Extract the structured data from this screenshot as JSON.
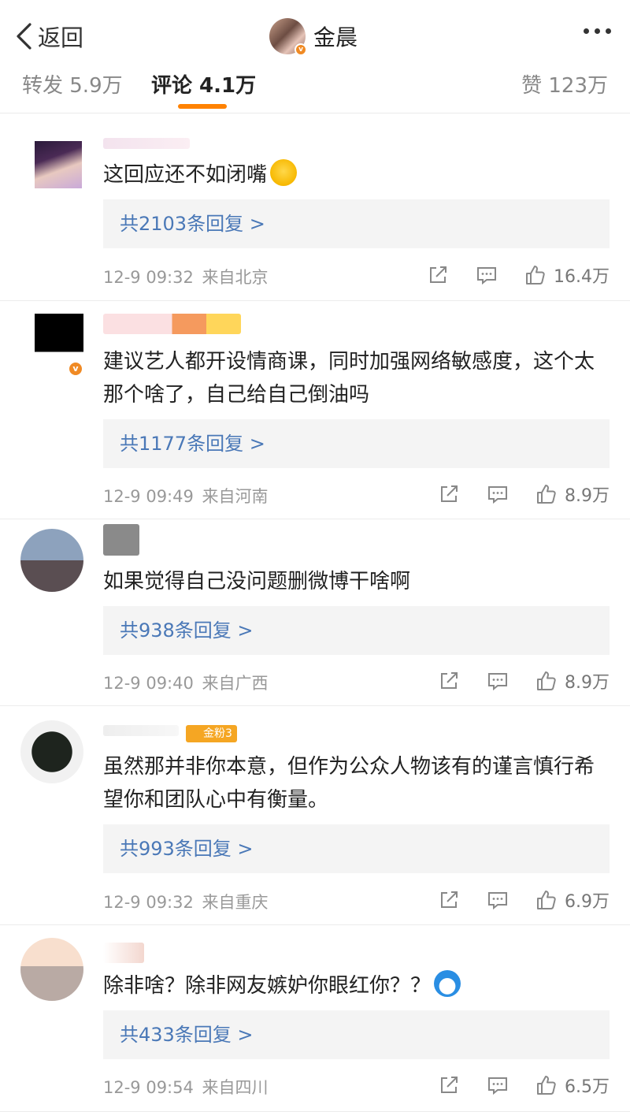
{
  "nav": {
    "back_label": "返回",
    "user_name": "金晨"
  },
  "tabs": {
    "repost": "转发 5.9万",
    "comment": "评论 4.1万",
    "like": "赞 123万"
  },
  "comments": [
    {
      "text": "这回应还不如闭嘴",
      "emoji": "crying-laughing-emoji",
      "replies": "共2103条回复 >",
      "time": "12-9 09:32",
      "location": "来自北京",
      "likes": "16.4万"
    },
    {
      "text": "建议艺人都开设情商课，同时加强网络敏感度，这个太那个啥了，自己给自己倒油吗",
      "replies": "共1177条回复 >",
      "time": "12-9 09:49",
      "location": "来自河南",
      "likes": "8.9万"
    },
    {
      "text": "如果觉得自己没问题删微博干啥啊",
      "replies": "共938条回复 >",
      "time": "12-9 09:40",
      "location": "来自广西",
      "likes": "8.9万"
    },
    {
      "text": "虽然那并非你本意，但作为公众人物该有的谨言慎行希望你和团队心中有衡量。",
      "fan_badge": "金粉3",
      "replies": "共993条回复 >",
      "time": "12-9 09:32",
      "location": "来自重庆",
      "likes": "6.9万"
    },
    {
      "text": "除非啥？除非网友嫉妒你眼红你？？",
      "emoji": "doraemon-emoji",
      "replies": "共433条回复 >",
      "time": "12-9 09:54",
      "location": "来自四川",
      "likes": "6.5万"
    }
  ],
  "colors": {
    "accent": "#ff8200",
    "link": "#4a78b7",
    "meta": "#999999"
  }
}
